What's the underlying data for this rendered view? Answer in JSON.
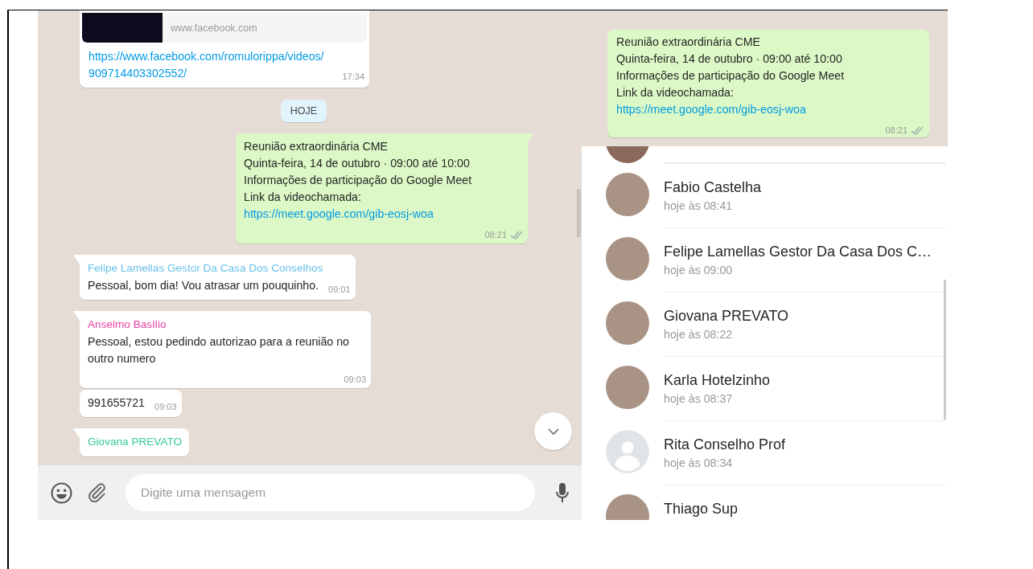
{
  "chat": {
    "messages": [
      {
        "kind": "link_preview",
        "outgoing": false,
        "domain": "www.facebook.com",
        "link": "https://www.facebook.com/romulorippa/videos/909714403302552/",
        "time": "17:34"
      },
      {
        "kind": "date",
        "text": "HOJE"
      },
      {
        "kind": "text",
        "outgoing": true,
        "lines": [
          "Reunião extraordinária CME",
          "Quinta-feira, 14 de outubro · 09:00 até 10:00",
          "Informações de participação do Google Meet",
          "Link da videochamada:"
        ],
        "link": "https://meet.google.com/gib-eosj-woa",
        "time": "08:21"
      },
      {
        "kind": "text",
        "outgoing": false,
        "sender": "Felipe Lamellas Gestor Da Casa Dos Conselhos",
        "color": "#6bc1ea",
        "lines": [
          "Pessoal, bom dia! Vou atrasar um pouquinho."
        ],
        "time": "09:01"
      },
      {
        "kind": "text",
        "outgoing": false,
        "sender": "Anselmo Basílio",
        "color": "#e542a3",
        "lines": [
          "Pessoal, estou pedindo autorizao para a reunião no outro numero"
        ],
        "time": "09:03"
      },
      {
        "kind": "text",
        "outgoing": false,
        "lines": [
          "991655721"
        ],
        "time": "09:03"
      },
      {
        "kind": "text",
        "outgoing": false,
        "sender": "Giovana PREVATO",
        "color": "#35cd96"
      }
    ],
    "composer": {
      "placeholder": "Digite uma mensagem"
    }
  },
  "info": {
    "message": {
      "kind": "text",
      "outgoing": true,
      "lines": [
        "Reunião extraordinária CME",
        "Quinta-feira, 14 de outubro · 09:00 até 10:00",
        "Informações de participação do Google Meet",
        "Link da videochamada:"
      ],
      "link": "https://meet.google.com/gib-eosj-woa",
      "time": "08:21"
    },
    "readers": [
      {
        "kind": "photo",
        "name": "Fabio Castelha",
        "time": "hoje às 08:41"
      },
      {
        "kind": "photo",
        "name": "Felipe Lamellas Gestor Da Casa Dos C…",
        "time": "hoje às 09:00"
      },
      {
        "kind": "photo",
        "name": "Giovana PREVATO",
        "time": "hoje às 08:22"
      },
      {
        "kind": "photo",
        "name": "Karla Hotelzinho",
        "time": "hoje às 08:37"
      },
      {
        "kind": "default",
        "name": "Rita Conselho Prof",
        "time": "hoje às 08:34"
      },
      {
        "kind": "photo",
        "name": "Thiago Sup"
      }
    ]
  }
}
